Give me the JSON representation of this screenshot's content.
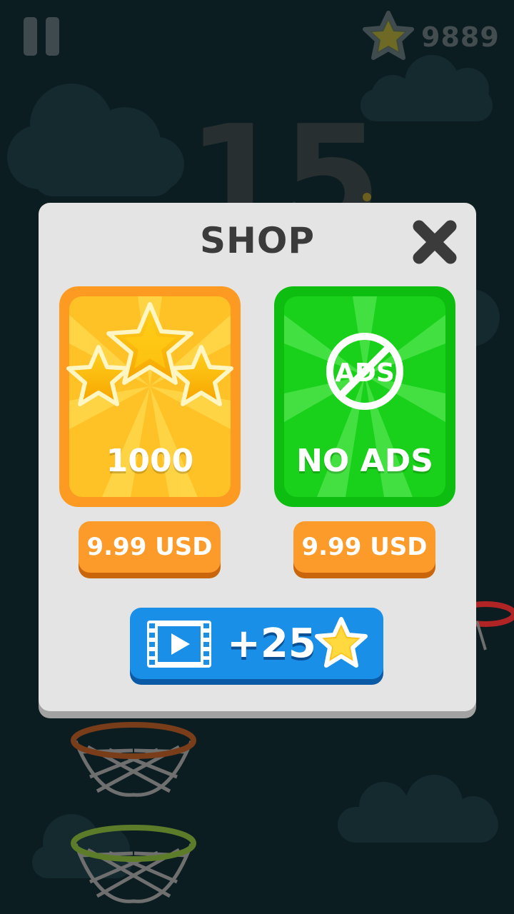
{
  "hud": {
    "pause_icon": "pause-icon",
    "star_icon": "star-icon",
    "star_total": "9889",
    "current_score": "15"
  },
  "shop": {
    "title": "SHOP",
    "close_icon": "close-icon",
    "stars_pack": {
      "label": "1000",
      "price": "9.99 USD",
      "icon": "three-stars-icon"
    },
    "no_ads_pack": {
      "label": "NO ADS",
      "price": "9.99 USD",
      "icon": "no-ads-icon",
      "icon_text": "ADS"
    },
    "video_reward": {
      "icon": "video-film-icon",
      "label": "+25",
      "reward_icon": "star-icon"
    }
  },
  "colors": {
    "background": "#0c1d22",
    "panel": "#e4e4e4",
    "orange_button": "#fc9a2a",
    "stars_card": "#fbbf1c",
    "no_ads_card": "#19d11a",
    "video_button": "#1a8fe8"
  }
}
